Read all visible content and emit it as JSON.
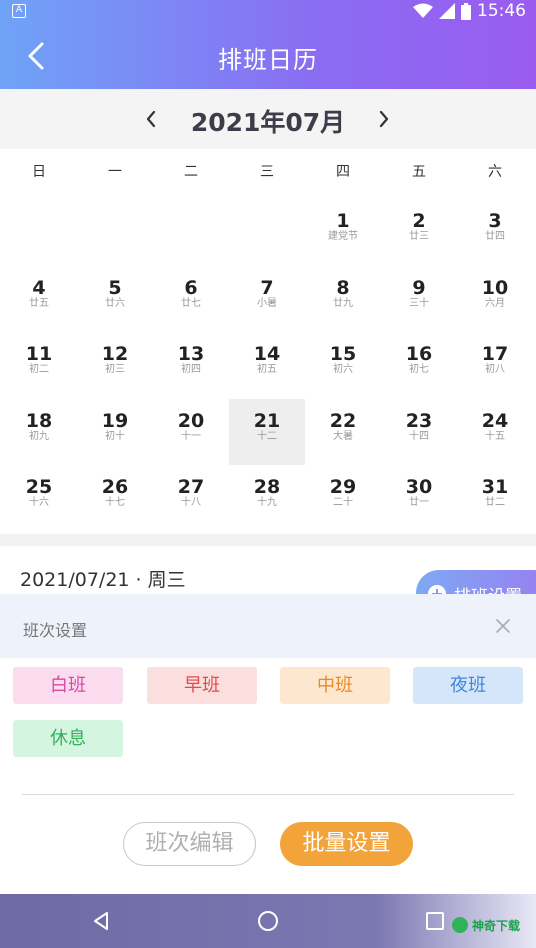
{
  "status_bar": {
    "time": "15:46",
    "left_icon": "A"
  },
  "header": {
    "title": "排班日历"
  },
  "month": {
    "label": "2021年07月"
  },
  "weekdays": [
    "日",
    "一",
    "二",
    "三",
    "四",
    "五",
    "六"
  ],
  "days": [
    {
      "num": "1",
      "lunar": "建党节"
    },
    {
      "num": "2",
      "lunar": "廿三"
    },
    {
      "num": "3",
      "lunar": "廿四"
    },
    {
      "num": "4",
      "lunar": "廿五"
    },
    {
      "num": "5",
      "lunar": "廿六"
    },
    {
      "num": "6",
      "lunar": "廿七"
    },
    {
      "num": "7",
      "lunar": "小暑"
    },
    {
      "num": "8",
      "lunar": "廿九"
    },
    {
      "num": "9",
      "lunar": "三十"
    },
    {
      "num": "10",
      "lunar": "六月"
    },
    {
      "num": "11",
      "lunar": "初二"
    },
    {
      "num": "12",
      "lunar": "初三"
    },
    {
      "num": "13",
      "lunar": "初四"
    },
    {
      "num": "14",
      "lunar": "初五"
    },
    {
      "num": "15",
      "lunar": "初六"
    },
    {
      "num": "16",
      "lunar": "初七"
    },
    {
      "num": "17",
      "lunar": "初八"
    },
    {
      "num": "18",
      "lunar": "初九"
    },
    {
      "num": "19",
      "lunar": "初十"
    },
    {
      "num": "20",
      "lunar": "十一"
    },
    {
      "num": "21",
      "lunar": "十二",
      "selected": true
    },
    {
      "num": "22",
      "lunar": "大暑"
    },
    {
      "num": "23",
      "lunar": "十四"
    },
    {
      "num": "24",
      "lunar": "十五"
    },
    {
      "num": "25",
      "lunar": "十六"
    },
    {
      "num": "26",
      "lunar": "十七"
    },
    {
      "num": "27",
      "lunar": "十八"
    },
    {
      "num": "28",
      "lunar": "十九"
    },
    {
      "num": "29",
      "lunar": "二十"
    },
    {
      "num": "30",
      "lunar": "廿一"
    },
    {
      "num": "31",
      "lunar": "廿二"
    }
  ],
  "selected_date": {
    "label": "2021/07/21 · 周三"
  },
  "fab": {
    "label": "排班设置"
  },
  "shift_sheet": {
    "title": "班次设置",
    "shifts": [
      {
        "label": "白班",
        "bg": "#fbdcef",
        "fg": "#d94aa6"
      },
      {
        "label": "早班",
        "bg": "#fbdfdf",
        "fg": "#e04c4c"
      },
      {
        "label": "中班",
        "bg": "#fde8cf",
        "fg": "#e88a2a"
      },
      {
        "label": "夜班",
        "bg": "#d6e6fa",
        "fg": "#3e86e0"
      },
      {
        "label": "休息",
        "bg": "#d4f5e0",
        "fg": "#2fb25a"
      }
    ],
    "edit_label": "班次编辑",
    "batch_label": "批量设置"
  },
  "watermark": {
    "text": "神奇下载"
  },
  "colors": {
    "accent_start": "#6fa3f7",
    "accent_end": "#9a5cf0",
    "batch": "#f2a33a"
  }
}
